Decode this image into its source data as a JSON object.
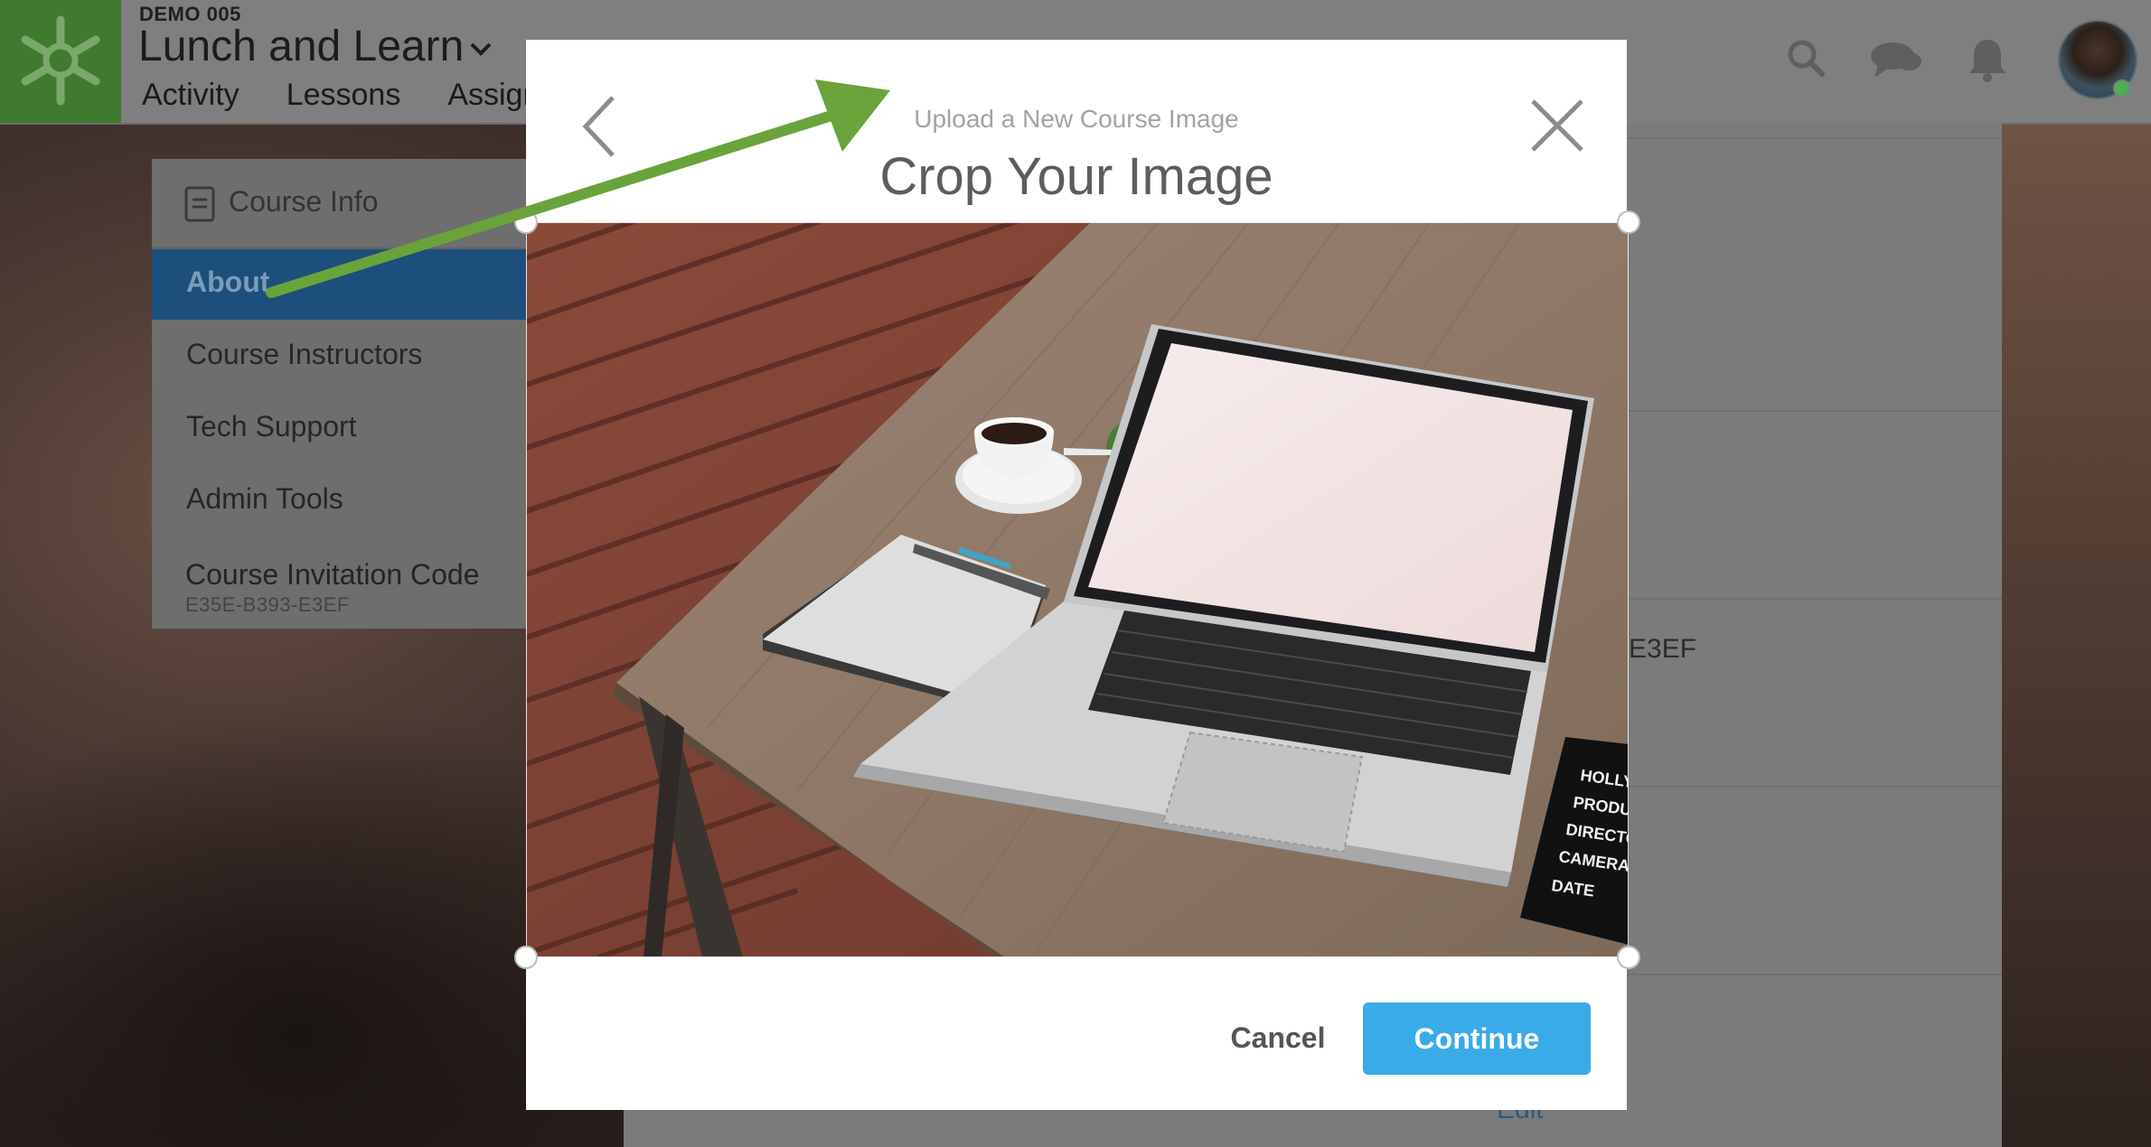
{
  "header": {
    "course_code": "DEMO 005",
    "course_title": "Lunch and Learn",
    "nav": [
      "Activity",
      "Lessons",
      "Assign"
    ]
  },
  "sidebar": {
    "header": "Course Info",
    "items": [
      {
        "label": "About",
        "active": true
      },
      {
        "label": "Course Instructors",
        "active": false
      },
      {
        "label": "Tech Support",
        "active": false
      },
      {
        "label": "Admin Tools",
        "active": false
      }
    ],
    "invitation_label": "Course Invitation Code",
    "invitation_code": "E35E-B393-E3EF"
  },
  "main": {
    "code_fragment": "E3EF",
    "edit_label": "Edit"
  },
  "modal": {
    "subtitle": "Upload a New Course Image",
    "title": "Crop Your Image",
    "cancel_label": "Cancel",
    "continue_label": "Continue",
    "clapperboard_lines": [
      "HOLLY",
      "PRODUC",
      "DIRECTO",
      "CAMERA",
      "DATE"
    ]
  },
  "colors": {
    "logo_green": "#3f7a2f",
    "active_blue": "#1d4f7c",
    "continue_blue": "#3aabe9",
    "arrow_green": "#6aa33a"
  },
  "icons": [
    "logo-icon",
    "chevron-down-icon",
    "search-icon",
    "chat-icon",
    "bell-icon",
    "document-icon",
    "back-arrow-icon",
    "close-icon"
  ]
}
